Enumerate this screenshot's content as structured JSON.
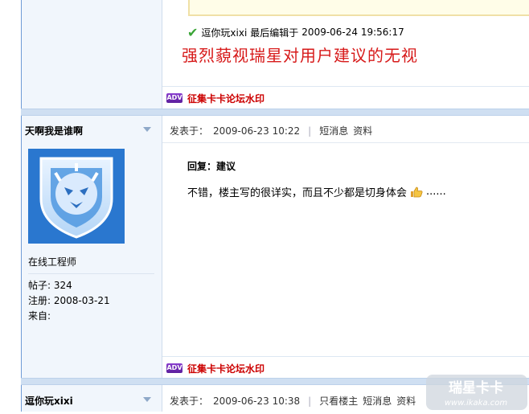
{
  "prev_post": {
    "edit_user": "逗你玩xixi",
    "edit_label": "最后编辑于",
    "edit_time": "2009-06-24 19:56:17",
    "signature": "强烈藐视瑞星对用户建议的无视"
  },
  "adv": {
    "badge": "ADV",
    "link_text": "征集卡卡论坛水印"
  },
  "post": {
    "author": "天啊我是谁啊",
    "posted_label": "发表于：",
    "posted_time": "2009-06-23 10:22",
    "links": [
      "短消息",
      "资料"
    ],
    "user_title": "在线工程师",
    "stats": [
      {
        "label": "帖子:",
        "value": "324"
      },
      {
        "label": "注册:",
        "value": "2008-03-21"
      },
      {
        "label": "来自:",
        "value": ""
      }
    ],
    "reply_title": "回复：建议",
    "reply_text": "不错，楼主写的很详实，而且不少都是切身体会",
    "reply_tail": "......"
  },
  "next_post": {
    "author": "逗你玩xixi",
    "posted_label": "发表于：",
    "posted_time": "2009-06-23 10:38",
    "links": [
      "只看楼主",
      "短消息",
      "资料"
    ]
  },
  "watermark": {
    "brand": "瑞星卡卡",
    "url": "www.ikaka.com"
  },
  "colors": {
    "signature": "#d71a1a",
    "adv_link": "#cc0000",
    "separator": "#cfdff2"
  }
}
